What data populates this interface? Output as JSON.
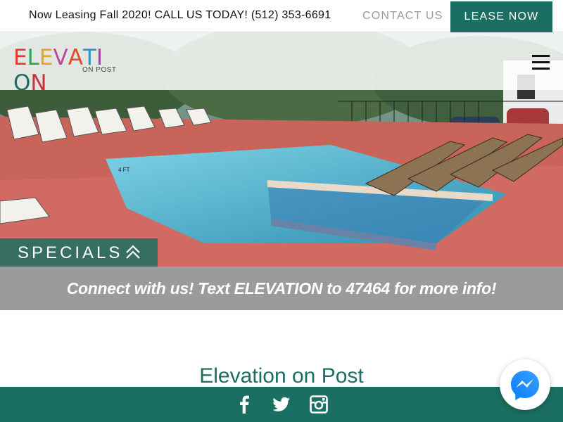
{
  "topbar": {
    "promo": "Now Leasing Fall 2020! CALL US TODAY! (512) 353-6691",
    "contact_label": "CONTACT US",
    "lease_label": "LEASE NOW"
  },
  "header": {
    "logo_letters": [
      "E",
      "L",
      "E",
      "V",
      "A",
      "T",
      "I",
      "O",
      "N"
    ],
    "logo_sub": "ON POST",
    "menu_icon": "hamburger-icon"
  },
  "hero": {
    "specials_label": "SPECIALS",
    "specials_icon": "double-chevron-up-icon",
    "pool_depth_label": "4 FT"
  },
  "banner": {
    "text": "Connect with us! Text ELEVATION to 47464 for more info!"
  },
  "main": {
    "title": "Elevation on Post"
  },
  "footer": {
    "social": [
      "facebook-icon",
      "twitter-icon",
      "instagram-icon"
    ]
  },
  "chat": {
    "icon": "messenger-icon"
  },
  "colors": {
    "brand_green": "#1b6e62",
    "banner_gray": "#999b9c",
    "logo": [
      "#e63a2e",
      "#2aa25a",
      "#e8a41d",
      "#b64c9a",
      "#e24b2a",
      "#2a95c8",
      "#9c4b9a",
      "#1b6e62",
      "#c7323a"
    ]
  }
}
